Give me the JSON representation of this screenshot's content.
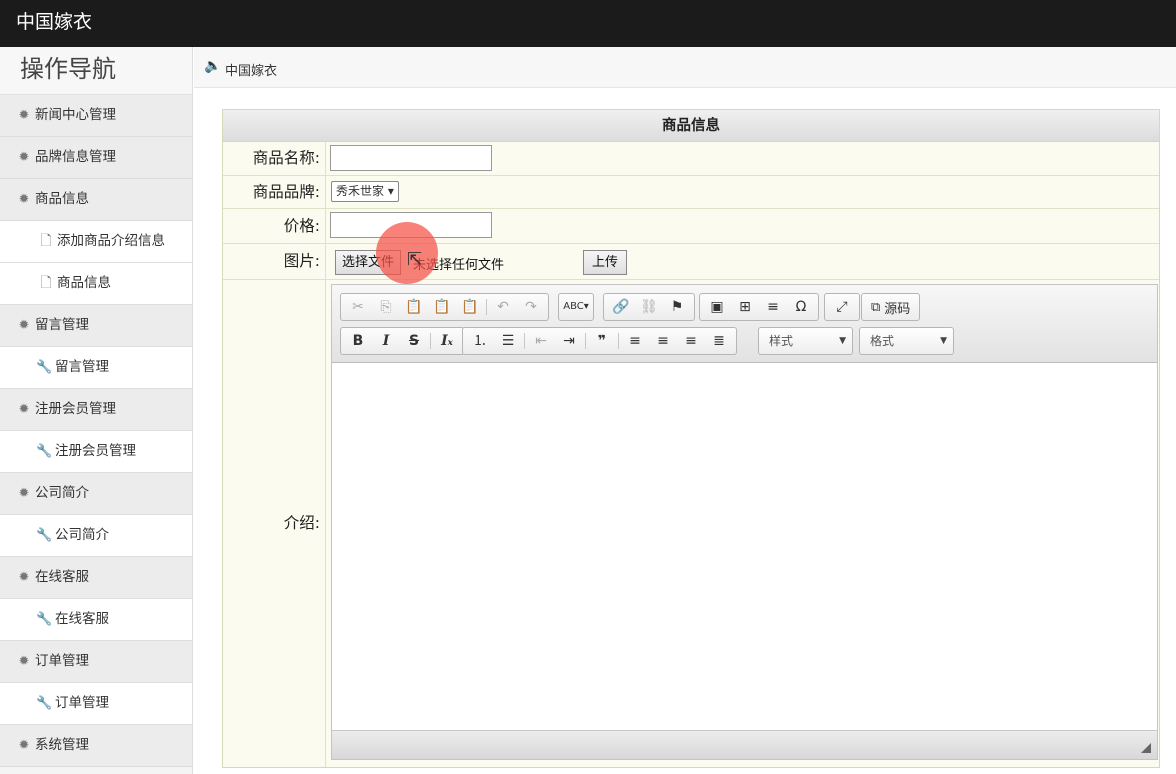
{
  "app": {
    "title": "中国嫁衣"
  },
  "sidebar": {
    "title": "操作导航",
    "items": [
      {
        "label": "新闻中心管理",
        "icon": "gear-icon"
      },
      {
        "label": "品牌信息管理",
        "icon": "gear-icon"
      },
      {
        "label": "商品信息",
        "icon": "gear-icon"
      },
      {
        "label": "添加商品介绍信息",
        "icon": "document-icon"
      },
      {
        "label": "商品信息",
        "icon": "document-icon"
      },
      {
        "label": "留言管理",
        "icon": "gear-icon"
      },
      {
        "label": "留言管理",
        "icon": "wrench-icon"
      },
      {
        "label": "注册会员管理",
        "icon": "gear-icon"
      },
      {
        "label": "注册会员管理",
        "icon": "wrench-icon"
      },
      {
        "label": "公司简介",
        "icon": "gear-icon"
      },
      {
        "label": "公司简介",
        "icon": "wrench-icon"
      },
      {
        "label": "在线客服",
        "icon": "gear-icon"
      },
      {
        "label": "在线客服",
        "icon": "wrench-icon"
      },
      {
        "label": "订单管理",
        "icon": "gear-icon"
      },
      {
        "label": "订单管理",
        "icon": "wrench-icon"
      },
      {
        "label": "系统管理",
        "icon": "gear-icon"
      }
    ]
  },
  "breadcrumb": {
    "icon": "speaker-icon",
    "text": "中国嫁衣"
  },
  "form": {
    "title": "商品信息",
    "name_label": "商品名称:",
    "name_value": "",
    "brand_label": "商品品牌:",
    "brand_selected": "秀禾世家",
    "price_label": "价格:",
    "price_value": "",
    "image_label": "图片:",
    "file_button": "选择文件",
    "file_status": "未选择任何文件",
    "upload_button": "上传",
    "intro_label": "介绍:"
  },
  "editor": {
    "source_label": "源码",
    "style_combo": "样式",
    "format_combo": "格式"
  },
  "colors": {
    "topbar": "#1b1b1b",
    "form_border": "#d6d9b8",
    "click_indicator": "#f55046"
  }
}
